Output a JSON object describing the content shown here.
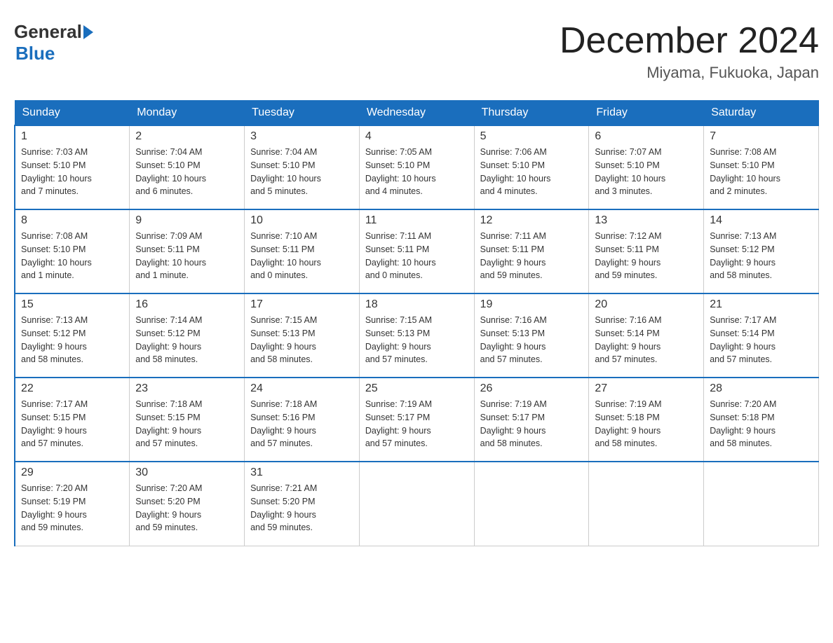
{
  "header": {
    "logo_general": "General",
    "logo_blue": "Blue",
    "month_title": "December 2024",
    "location": "Miyama, Fukuoka, Japan"
  },
  "columns": [
    "Sunday",
    "Monday",
    "Tuesday",
    "Wednesday",
    "Thursday",
    "Friday",
    "Saturday"
  ],
  "weeks": [
    [
      {
        "day": "1",
        "sunrise": "Sunrise: 7:03 AM",
        "sunset": "Sunset: 5:10 PM",
        "daylight": "Daylight: 10 hours",
        "minutes": "and 7 minutes."
      },
      {
        "day": "2",
        "sunrise": "Sunrise: 7:04 AM",
        "sunset": "Sunset: 5:10 PM",
        "daylight": "Daylight: 10 hours",
        "minutes": "and 6 minutes."
      },
      {
        "day": "3",
        "sunrise": "Sunrise: 7:04 AM",
        "sunset": "Sunset: 5:10 PM",
        "daylight": "Daylight: 10 hours",
        "minutes": "and 5 minutes."
      },
      {
        "day": "4",
        "sunrise": "Sunrise: 7:05 AM",
        "sunset": "Sunset: 5:10 PM",
        "daylight": "Daylight: 10 hours",
        "minutes": "and 4 minutes."
      },
      {
        "day": "5",
        "sunrise": "Sunrise: 7:06 AM",
        "sunset": "Sunset: 5:10 PM",
        "daylight": "Daylight: 10 hours",
        "minutes": "and 4 minutes."
      },
      {
        "day": "6",
        "sunrise": "Sunrise: 7:07 AM",
        "sunset": "Sunset: 5:10 PM",
        "daylight": "Daylight: 10 hours",
        "minutes": "and 3 minutes."
      },
      {
        "day": "7",
        "sunrise": "Sunrise: 7:08 AM",
        "sunset": "Sunset: 5:10 PM",
        "daylight": "Daylight: 10 hours",
        "minutes": "and 2 minutes."
      }
    ],
    [
      {
        "day": "8",
        "sunrise": "Sunrise: 7:08 AM",
        "sunset": "Sunset: 5:10 PM",
        "daylight": "Daylight: 10 hours",
        "minutes": "and 1 minute."
      },
      {
        "day": "9",
        "sunrise": "Sunrise: 7:09 AM",
        "sunset": "Sunset: 5:11 PM",
        "daylight": "Daylight: 10 hours",
        "minutes": "and 1 minute."
      },
      {
        "day": "10",
        "sunrise": "Sunrise: 7:10 AM",
        "sunset": "Sunset: 5:11 PM",
        "daylight": "Daylight: 10 hours",
        "minutes": "and 0 minutes."
      },
      {
        "day": "11",
        "sunrise": "Sunrise: 7:11 AM",
        "sunset": "Sunset: 5:11 PM",
        "daylight": "Daylight: 10 hours",
        "minutes": "and 0 minutes."
      },
      {
        "day": "12",
        "sunrise": "Sunrise: 7:11 AM",
        "sunset": "Sunset: 5:11 PM",
        "daylight": "Daylight: 9 hours",
        "minutes": "and 59 minutes."
      },
      {
        "day": "13",
        "sunrise": "Sunrise: 7:12 AM",
        "sunset": "Sunset: 5:11 PM",
        "daylight": "Daylight: 9 hours",
        "minutes": "and 59 minutes."
      },
      {
        "day": "14",
        "sunrise": "Sunrise: 7:13 AM",
        "sunset": "Sunset: 5:12 PM",
        "daylight": "Daylight: 9 hours",
        "minutes": "and 58 minutes."
      }
    ],
    [
      {
        "day": "15",
        "sunrise": "Sunrise: 7:13 AM",
        "sunset": "Sunset: 5:12 PM",
        "daylight": "Daylight: 9 hours",
        "minutes": "and 58 minutes."
      },
      {
        "day": "16",
        "sunrise": "Sunrise: 7:14 AM",
        "sunset": "Sunset: 5:12 PM",
        "daylight": "Daylight: 9 hours",
        "minutes": "and 58 minutes."
      },
      {
        "day": "17",
        "sunrise": "Sunrise: 7:15 AM",
        "sunset": "Sunset: 5:13 PM",
        "daylight": "Daylight: 9 hours",
        "minutes": "and 58 minutes."
      },
      {
        "day": "18",
        "sunrise": "Sunrise: 7:15 AM",
        "sunset": "Sunset: 5:13 PM",
        "daylight": "Daylight: 9 hours",
        "minutes": "and 57 minutes."
      },
      {
        "day": "19",
        "sunrise": "Sunrise: 7:16 AM",
        "sunset": "Sunset: 5:13 PM",
        "daylight": "Daylight: 9 hours",
        "minutes": "and 57 minutes."
      },
      {
        "day": "20",
        "sunrise": "Sunrise: 7:16 AM",
        "sunset": "Sunset: 5:14 PM",
        "daylight": "Daylight: 9 hours",
        "minutes": "and 57 minutes."
      },
      {
        "day": "21",
        "sunrise": "Sunrise: 7:17 AM",
        "sunset": "Sunset: 5:14 PM",
        "daylight": "Daylight: 9 hours",
        "minutes": "and 57 minutes."
      }
    ],
    [
      {
        "day": "22",
        "sunrise": "Sunrise: 7:17 AM",
        "sunset": "Sunset: 5:15 PM",
        "daylight": "Daylight: 9 hours",
        "minutes": "and 57 minutes."
      },
      {
        "day": "23",
        "sunrise": "Sunrise: 7:18 AM",
        "sunset": "Sunset: 5:15 PM",
        "daylight": "Daylight: 9 hours",
        "minutes": "and 57 minutes."
      },
      {
        "day": "24",
        "sunrise": "Sunrise: 7:18 AM",
        "sunset": "Sunset: 5:16 PM",
        "daylight": "Daylight: 9 hours",
        "minutes": "and 57 minutes."
      },
      {
        "day": "25",
        "sunrise": "Sunrise: 7:19 AM",
        "sunset": "Sunset: 5:17 PM",
        "daylight": "Daylight: 9 hours",
        "minutes": "and 57 minutes."
      },
      {
        "day": "26",
        "sunrise": "Sunrise: 7:19 AM",
        "sunset": "Sunset: 5:17 PM",
        "daylight": "Daylight: 9 hours",
        "minutes": "and 58 minutes."
      },
      {
        "day": "27",
        "sunrise": "Sunrise: 7:19 AM",
        "sunset": "Sunset: 5:18 PM",
        "daylight": "Daylight: 9 hours",
        "minutes": "and 58 minutes."
      },
      {
        "day": "28",
        "sunrise": "Sunrise: 7:20 AM",
        "sunset": "Sunset: 5:18 PM",
        "daylight": "Daylight: 9 hours",
        "minutes": "and 58 minutes."
      }
    ],
    [
      {
        "day": "29",
        "sunrise": "Sunrise: 7:20 AM",
        "sunset": "Sunset: 5:19 PM",
        "daylight": "Daylight: 9 hours",
        "minutes": "and 59 minutes."
      },
      {
        "day": "30",
        "sunrise": "Sunrise: 7:20 AM",
        "sunset": "Sunset: 5:20 PM",
        "daylight": "Daylight: 9 hours",
        "minutes": "and 59 minutes."
      },
      {
        "day": "31",
        "sunrise": "Sunrise: 7:21 AM",
        "sunset": "Sunset: 5:20 PM",
        "daylight": "Daylight: 9 hours",
        "minutes": "and 59 minutes."
      },
      null,
      null,
      null,
      null
    ]
  ]
}
